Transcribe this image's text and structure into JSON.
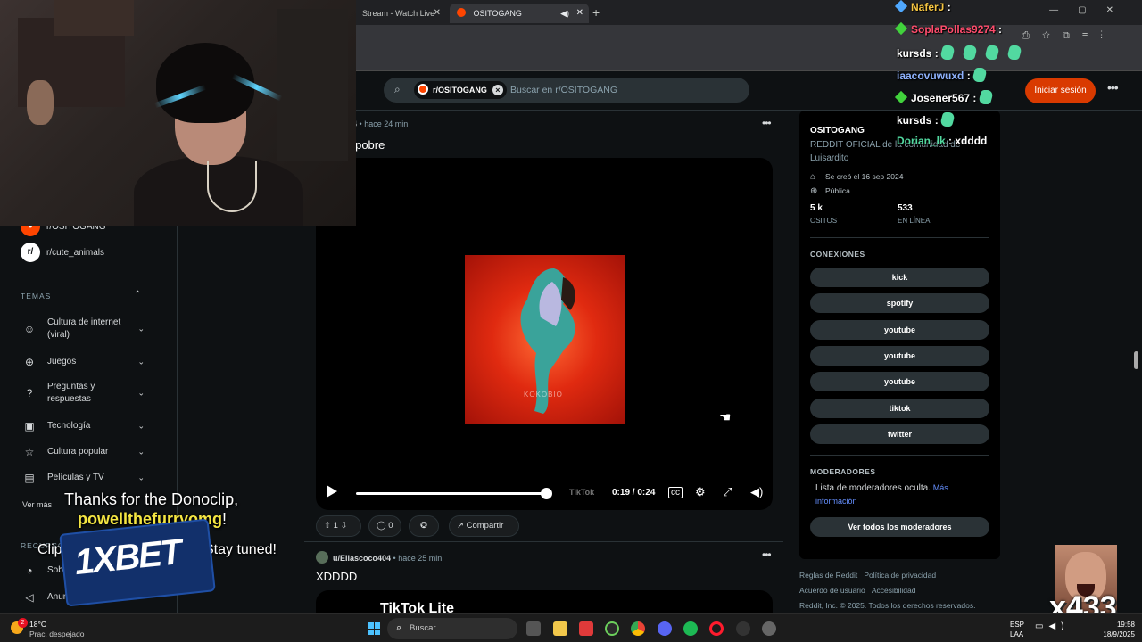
{
  "browser": {
    "tabs": [
      {
        "label": "Stream - Watch Live"
      },
      {
        "label": "OSITOGANG"
      }
    ]
  },
  "header": {
    "search_chip": "r/OSITOGANG",
    "search_placeholder": "Buscar en r/OSITOGANG",
    "login_label": "Iniciar sesión"
  },
  "sidebar": {
    "communities": [
      {
        "name": "r/OSITOGANG"
      },
      {
        "name": "r/cute_animals"
      }
    ],
    "topics_heading": "TEMAS",
    "topics": [
      {
        "label": "Cultura de internet (viral)",
        "icon": "smiley-icon"
      },
      {
        "label": "Juegos",
        "icon": "gamepad-icon"
      },
      {
        "label": "Preguntas y respuestas",
        "icon": "question-icon"
      },
      {
        "label": "Tecnología",
        "icon": "chip-icon"
      },
      {
        "label": "Cultura popular",
        "icon": "star-icon"
      },
      {
        "label": "Películas y TV",
        "icon": "clapper-icon"
      }
    ],
    "more_label": "Ver más",
    "resources_heading": "RECURSOS",
    "resources": [
      "Sobre",
      "Anun"
    ]
  },
  "posts": [
    {
      "author": "u/Eliascoco404",
      "author_visible": "ascoco404",
      "time": "hace 24 min",
      "title": "el cospobre",
      "title_prefix": "z",
      "video": {
        "current_time": "0:19",
        "duration": "0:24",
        "progress": 0.79,
        "watermark": "KOKOBIO",
        "overlay_brand": "TikTok"
      },
      "votes": "1",
      "comments": "0",
      "share_label": "Compartir"
    },
    {
      "author": "u/Eliascoco404",
      "time": "hace 25 min",
      "title": "XDDDD",
      "video_brand": "TikTok Lite"
    }
  ],
  "community": {
    "name": "OSITOGANG",
    "description": "REDDIT OFICIAL de la comunidad de Luisardito",
    "created": "Se creó el 16 sep 2024",
    "visibility": "Pública",
    "members": {
      "value": "5 k",
      "label": "OSITOS"
    },
    "online": {
      "value": "533",
      "label": "EN LÍNEA"
    },
    "connections_heading": "CONEXIONES",
    "connections": [
      "kick",
      "spotify",
      "youtube",
      "youtube",
      "youtube",
      "tiktok",
      "twitter"
    ],
    "moderators_heading": "MODERADORES",
    "moderators_text": "Lista de moderadores oculta.",
    "moderators_link": "Más información",
    "moderators_button": "Ver todos los moderadores"
  },
  "footer": {
    "links": [
      "Reglas de Reddit",
      "Política de privacidad",
      "Acuerdo de usuario",
      "Accesibilidad"
    ],
    "copyright": "Reddit, Inc. © 2025. Todos los derechos reservados."
  },
  "stream_chat": [
    {
      "user": "NaferJ",
      "text": "",
      "color": "#f5c542"
    },
    {
      "user": "SoplaPollas9274",
      "text": "",
      "color": "#ff4d6d"
    },
    {
      "user": "kursds",
      "text": "",
      "color": "#ffffff"
    },
    {
      "user": "iaacovuwuxd",
      "text": "",
      "color": "#8fb3ff"
    },
    {
      "user": "Josener567",
      "text": "",
      "color": "#ffffff"
    },
    {
      "user": "kursds",
      "text": "",
      "color": "#ffffff"
    },
    {
      "user": "Dorian_lk",
      "text": "xdddd",
      "color": "#52d9a0"
    }
  ],
  "donoclip": {
    "line1": "Thanks for the Donoclip,",
    "donor": "powellthefurryomg",
    "donor_suffix": "!",
    "line3a": "Clip",
    "line3b": "Stay tuned!",
    "sponsor": "1XBET"
  },
  "corner_overlay": {
    "counter": "x433"
  },
  "taskbar": {
    "notification_count": "2",
    "temperature": "18°C",
    "condition": "Prac. despejado",
    "search_label": "Buscar",
    "lang1": "ESP",
    "lang2": "LAA",
    "time": "19:58",
    "date": "18/9/2025"
  }
}
